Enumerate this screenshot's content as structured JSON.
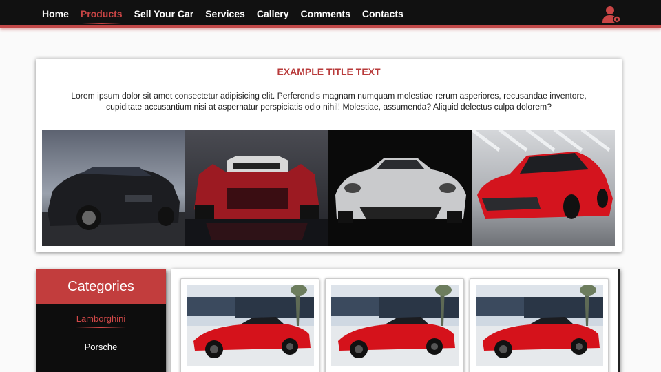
{
  "nav": {
    "links": [
      {
        "label": "Home",
        "active": false
      },
      {
        "label": "Products",
        "active": true
      },
      {
        "label": "Sell Your Car",
        "active": false
      },
      {
        "label": "Services",
        "active": false
      },
      {
        "label": "Callery",
        "active": false
      },
      {
        "label": "Comments",
        "active": false
      },
      {
        "label": "Contacts",
        "active": false
      }
    ],
    "user_icon": "user-settings-icon"
  },
  "hero": {
    "title": "EXAMPLE TITLE TEXT",
    "text": "Lorem ipsum dolor sit amet consectetur adipisicing elit. Perferendis magnam numquam molestiae rerum asperiores, recusandae inventore, cupiditate accusantium nisi at aspernatur perspiciatis odio nihil! Molestiae, assumenda? Aliquid delectus culpa dolorem?",
    "gallery": [
      "black-bmw-coupe",
      "red-citroen-race-car",
      "silver-zenvo-supercar",
      "red-acura-nsx"
    ]
  },
  "categories": {
    "title": "Categories",
    "items": [
      {
        "label": "Lamborghini",
        "active": true
      },
      {
        "label": "Porsche",
        "active": false
      }
    ]
  },
  "products": [
    "red-lamborghini",
    "red-lamborghini",
    "red-lamborghini"
  ],
  "colors": {
    "accent": "#c23d3d",
    "nav_bg": "#111111",
    "sidebar_bg": "#0d0d0d"
  }
}
